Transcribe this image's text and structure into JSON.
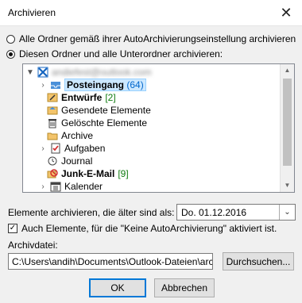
{
  "window": {
    "title": "Archivieren",
    "close_glyph": "✕"
  },
  "options": {
    "radio_all": "Alle Ordner gemäß ihrer AutoArchivierungseinstellung archivieren",
    "radio_this": "Diesen Ordner und alle Unterordner archivieren:"
  },
  "tree": {
    "account": "andiefest@outlook.com",
    "folders": [
      {
        "label": "Posteingang",
        "count": "(64)",
        "icon": "inbox-icon"
      },
      {
        "label": "Entwürfe",
        "count": "[2]",
        "icon": "drafts-icon"
      },
      {
        "label": "Gesendete Elemente",
        "count": "",
        "icon": "sent-icon"
      },
      {
        "label": "Gelöschte Elemente",
        "count": "",
        "icon": "trash-icon"
      },
      {
        "label": "Archive",
        "count": "",
        "icon": "folder-icon"
      },
      {
        "label": "Aufgaben",
        "count": "",
        "icon": "tasks-icon"
      },
      {
        "label": "Journal",
        "count": "",
        "icon": "journal-icon"
      },
      {
        "label": "Junk-E-Mail",
        "count": "[9]",
        "icon": "junk-icon"
      },
      {
        "label": "Kalender",
        "count": "",
        "icon": "calendar-icon"
      }
    ]
  },
  "archive_older": {
    "label": "Elemente archivieren, die älter sind als:",
    "date": "Do. 01.12.2016"
  },
  "include_no_autoarchive": {
    "label": "Auch Elemente, für die \"Keine AutoArchivierung\" aktiviert ist.",
    "check": "✓"
  },
  "archive_file": {
    "label": "Archivdatei:",
    "path": "C:\\Users\\andih\\Documents\\Outlook-Dateien\\archive.pst",
    "browse": "Durchsuchen..."
  },
  "buttons": {
    "ok": "OK",
    "cancel": "Abbrechen"
  },
  "colors": {
    "selection": "#cce8ff",
    "count_blue": "#0066cc",
    "count_green": "#107c10"
  }
}
